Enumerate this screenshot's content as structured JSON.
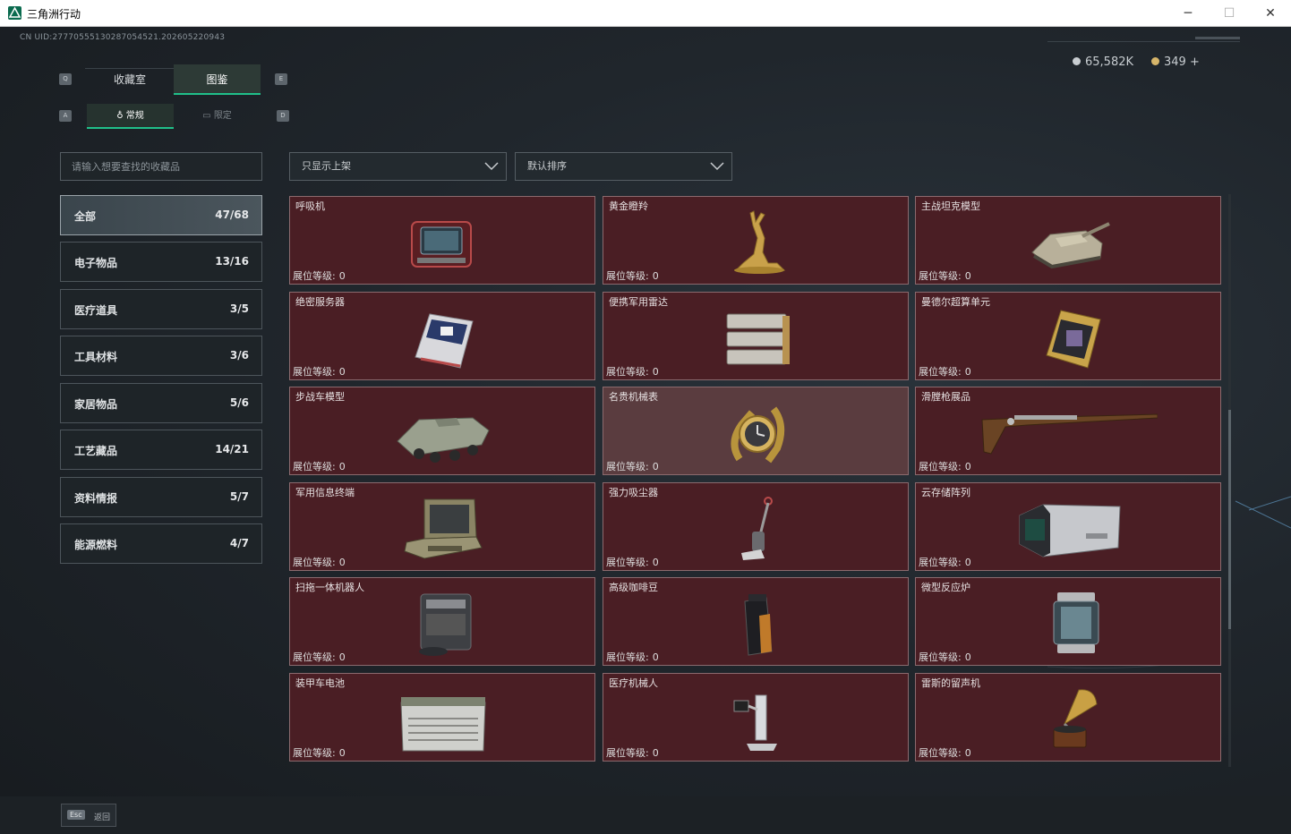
{
  "window": {
    "title": "三角洲行动",
    "controls": {
      "minimize": "─",
      "maximize": "☐",
      "close": "✕"
    }
  },
  "header": {
    "uid": "CN UID:27770555130287054521.202605220943",
    "currency": [
      {
        "icon": "silver-coin-icon",
        "value": "65,582K",
        "color": "#c8cdd1"
      },
      {
        "icon": "gold-coin-icon",
        "value": "349 +",
        "color": "#d6b56a"
      }
    ]
  },
  "tabs": {
    "key_left": "Q",
    "key_right": "E",
    "items": [
      {
        "label": "收藏室",
        "active": false
      },
      {
        "label": "图鉴",
        "active": true
      }
    ]
  },
  "subtabs": {
    "key_left": "A",
    "key_right": "D",
    "items": [
      {
        "label": "常规",
        "icon": "flame-icon",
        "active": true
      },
      {
        "label": "限定",
        "icon": "card-icon",
        "active": false
      }
    ]
  },
  "search": {
    "placeholder": "请输入想要查找的收藏品",
    "value": ""
  },
  "filters": {
    "availability": {
      "selected": "只显示上架"
    },
    "sort": {
      "selected": "默认排序"
    }
  },
  "categories": [
    {
      "name": "全部",
      "count": "47/68",
      "active": true
    },
    {
      "name": "电子物品",
      "count": "13/16",
      "active": false
    },
    {
      "name": "医疗道具",
      "count": "3/5",
      "active": false
    },
    {
      "name": "工具材料",
      "count": "3/6",
      "active": false
    },
    {
      "name": "家居物品",
      "count": "5/6",
      "active": false
    },
    {
      "name": "工艺藏品",
      "count": "14/21",
      "active": false
    },
    {
      "name": "资料情报",
      "count": "5/7",
      "active": false
    },
    {
      "name": "能源燃料",
      "count": "4/7",
      "active": false
    }
  ],
  "items": [
    {
      "name": "呼吸机",
      "level_label": "展位等级:",
      "level": "0",
      "icon": "respirator-icon"
    },
    {
      "name": "黄金瞪羚",
      "level_label": "展位等级:",
      "level": "0",
      "icon": "gold-gazelle-icon"
    },
    {
      "name": "主战坦克模型",
      "level_label": "展位等级:",
      "level": "0",
      "icon": "tank-model-icon"
    },
    {
      "name": "绝密服务器",
      "level_label": "展位等级:",
      "level": "0",
      "icon": "server-icon"
    },
    {
      "name": "便携军用雷达",
      "level_label": "展位等级:",
      "level": "0",
      "icon": "radar-icon"
    },
    {
      "name": "曼德尔超算单元",
      "level_label": "展位等级:",
      "level": "0",
      "icon": "supercomputer-icon"
    },
    {
      "name": "步战车模型",
      "level_label": "展位等级:",
      "level": "0",
      "icon": "ifv-model-icon"
    },
    {
      "name": "名贵机械表",
      "level_label": "展位等级:",
      "level": "0",
      "icon": "watch-icon",
      "highlight": true
    },
    {
      "name": "滑膛枪展品",
      "level_label": "展位等级:",
      "level": "0",
      "icon": "musket-icon"
    },
    {
      "name": "军用信息终端",
      "level_label": "展位等级:",
      "level": "0",
      "icon": "military-terminal-icon"
    },
    {
      "name": "强力吸尘器",
      "level_label": "展位等级:",
      "level": "0",
      "icon": "vacuum-icon"
    },
    {
      "name": "云存储阵列",
      "level_label": "展位等级:",
      "level": "0",
      "icon": "storage-array-icon"
    },
    {
      "name": "扫拖一体机器人",
      "level_label": "展位等级:",
      "level": "0",
      "icon": "robot-vacuum-icon"
    },
    {
      "name": "高级咖啡豆",
      "level_label": "展位等级:",
      "level": "0",
      "icon": "coffee-bag-icon"
    },
    {
      "name": "微型反应炉",
      "level_label": "展位等级:",
      "level": "0",
      "icon": "reactor-icon"
    },
    {
      "name": "装甲车电池",
      "level_label": "展位等级:",
      "level": "0",
      "icon": "battery-icon"
    },
    {
      "name": "医疗机械人",
      "level_label": "展位等级:",
      "level": "0",
      "icon": "medical-robot-icon"
    },
    {
      "name": "雷斯的留声机",
      "level_label": "展位等级:",
      "level": "0",
      "icon": "gramophone-icon"
    }
  ],
  "footer": {
    "esc_key": "Esc",
    "esc_label": "返回"
  }
}
